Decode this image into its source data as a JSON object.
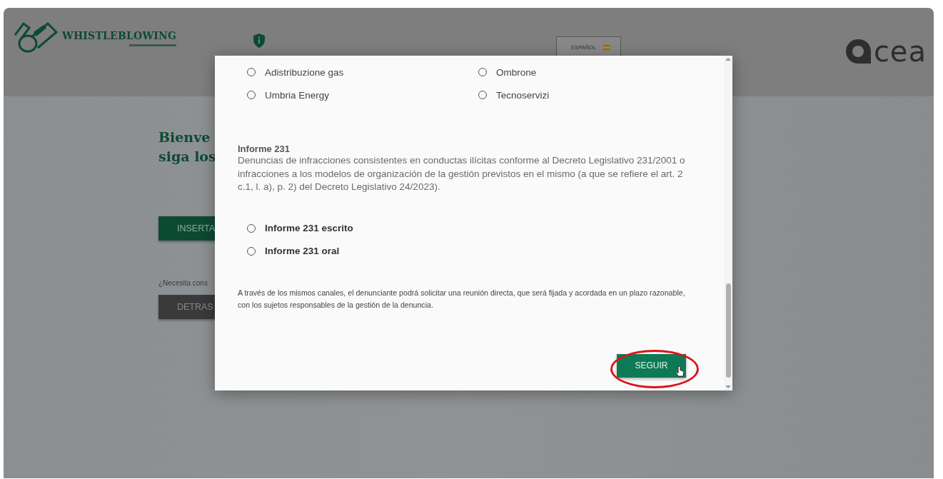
{
  "header": {
    "brand": "WHISTLEBLOWING",
    "language": "ESPAÑOL",
    "logo_text": "cea"
  },
  "background": {
    "heading_lines": [
      "Bienve",
      "siga los"
    ],
    "primary_button": "INSERTA",
    "help_text": "¿Necesita cons",
    "secondary_button": "DETRAS"
  },
  "modal": {
    "companies": [
      {
        "label": "Adistribuzione gas",
        "selected": false
      },
      {
        "label": "Ombrone",
        "selected": false
      },
      {
        "label": "Umbria Energy",
        "selected": false
      },
      {
        "label": "Tecnoservizi",
        "selected": false
      }
    ],
    "section_title": "Informe 231",
    "section_text": "Denuncias de infracciones consistentes en conductas ilícitas conforme al Decreto Legislativo 231/2001 o infracciones a los modelos de organización de la gestión previstos en el mismo (a que se refiere el art. 2 c.1, l. a), p. 2) del Decreto Legislativo 24/2023).",
    "report_types": [
      {
        "label": "Informe 231 escrito",
        "selected": false
      },
      {
        "label": "Informe 231 oral",
        "selected": false
      }
    ],
    "note": "A través de los mismos canales, el denunciante podrá solicitar una reunión directa, que será fijada y acordada en un plazo razonable, con los sujetos responsables de la gestión de la denuncia.",
    "submit_button": "SEGUIR"
  }
}
